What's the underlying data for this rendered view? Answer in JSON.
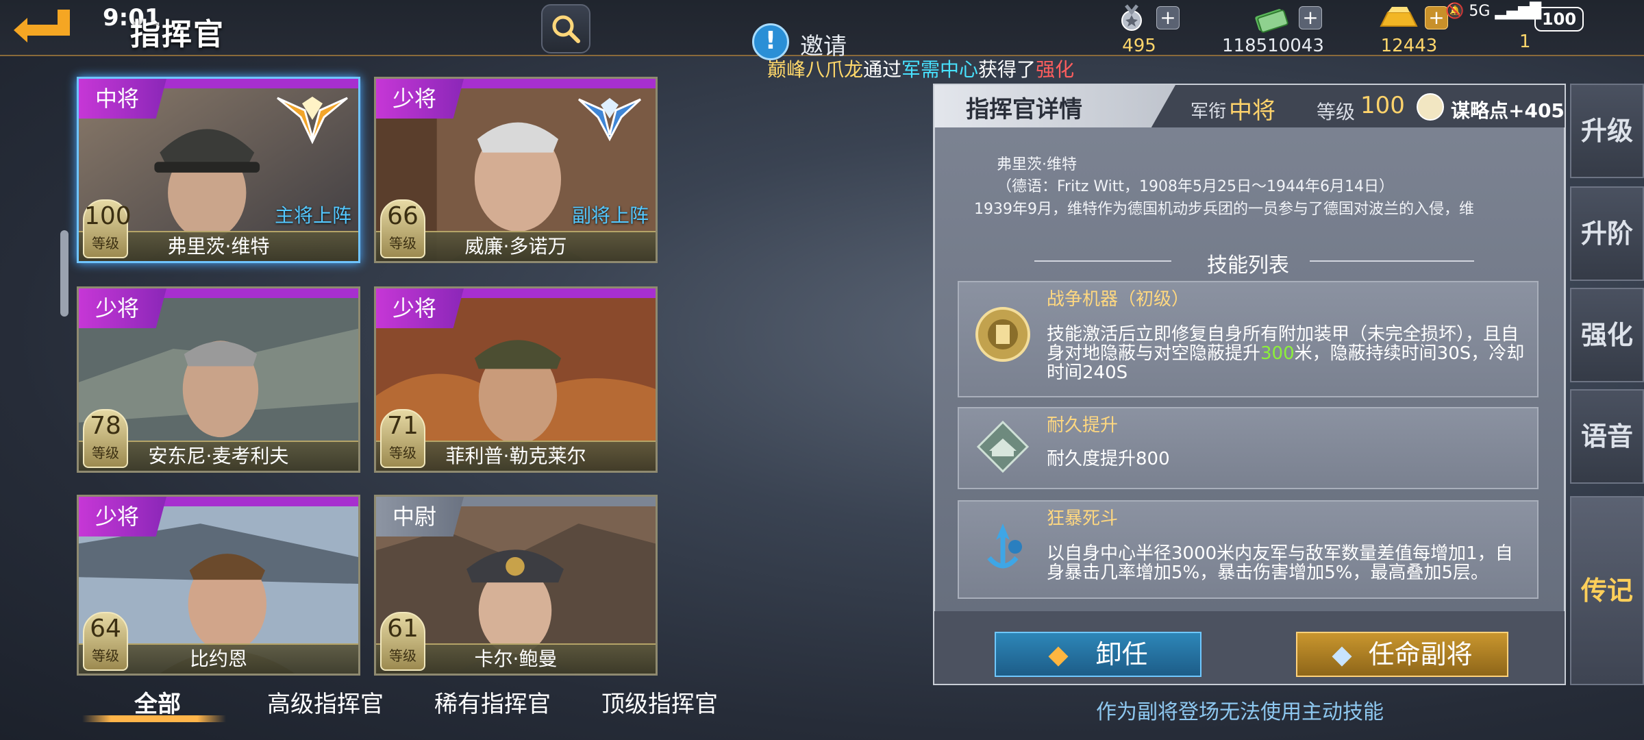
{
  "status_bar": {
    "time": "9:01",
    "signal": "5G",
    "battery": "100"
  },
  "header": {
    "title": "指挥官",
    "invite_label": "邀请",
    "marquee": {
      "player": "巅峰八爪龙",
      "via": "通过",
      "source": "军需中心",
      "got": "获得了",
      "item": "强化"
    }
  },
  "resources": [
    {
      "icon": "medal-icon",
      "value": "495",
      "has_plus": true
    },
    {
      "icon": "cash-icon",
      "value": "118510043",
      "has_plus": true
    },
    {
      "icon": "gold-bar-icon",
      "value": "12443",
      "has_plus": true
    },
    {
      "icon": "ticket-icon",
      "value": "1",
      "has_plus": false
    }
  ],
  "commanders": [
    {
      "rank": "中将",
      "name": "弗里茨·维特",
      "level": "100",
      "level_label": "等级",
      "deploy": "主将上阵",
      "selected": true,
      "rank_color": "purple"
    },
    {
      "rank": "少将",
      "name": "威廉·多诺万",
      "level": "66",
      "level_label": "等级",
      "deploy": "副将上阵",
      "selected": false,
      "rank_color": "purple"
    },
    {
      "rank": "少将",
      "name": "安东尼·麦考利夫",
      "level": "78",
      "level_label": "等级",
      "deploy": "",
      "selected": false,
      "rank_color": "purple"
    },
    {
      "rank": "少将",
      "name": "菲利普·勒克莱尔",
      "level": "71",
      "level_label": "等级",
      "deploy": "",
      "selected": false,
      "rank_color": "purple"
    },
    {
      "rank": "少将",
      "name": "比约恩",
      "level": "64",
      "level_label": "等级",
      "deploy": "",
      "selected": false,
      "rank_color": "purple"
    },
    {
      "rank": "中尉",
      "name": "卡尔·鲍曼",
      "level": "61",
      "level_label": "等级",
      "deploy": "",
      "selected": false,
      "rank_color": "gray"
    }
  ],
  "tabs": [
    {
      "label": "全部",
      "active": true
    },
    {
      "label": "高级指挥官",
      "active": false
    },
    {
      "label": "稀有指挥官",
      "active": false
    },
    {
      "label": "顶级指挥官",
      "active": false
    }
  ],
  "detail": {
    "title": "指挥官详情",
    "rank_label": "军衔",
    "rank_value": "中将",
    "level_label": "等级",
    "level_value": "100",
    "strategy": "谋略点+405",
    "bio_name": "弗里茨·维特",
    "bio_german": "（德语：Fritz Witt，1908年5月25日～1944年6月14日）",
    "bio_text": "1939年9月，维特作为德国机动步兵团的一员参与了德国对波兰的入侵，维",
    "skills_title": "技能列表",
    "skills": [
      {
        "name": "战争机器（初级）",
        "desc_a": "技能激活后立即修复自身所有附加装甲（未完全损坏），且自身对地隐蔽与对空隐蔽提升",
        "highlight": "300",
        "desc_b": "米，隐蔽持续时间30S，冷却时间240S",
        "icon": "war-machine-icon"
      },
      {
        "name": "耐久提升",
        "desc_a": "耐久度提升800",
        "highlight": "",
        "desc_b": "",
        "icon": "durability-icon"
      },
      {
        "name": "狂暴死斗",
        "desc_a": "以自身中心半径3000米内友军与敌军数量差值每增加1，自身暴击几率增加5%，暴击伤害增加5%，最高叠加5层。",
        "highlight": "",
        "desc_b": "",
        "icon": "berserk-icon"
      }
    ],
    "dismiss_label": "卸任",
    "appoint_label": "任命副将",
    "note": "作为副将登场无法使用主动技能"
  },
  "side_nav": [
    {
      "label": "升级",
      "active": false
    },
    {
      "label": "升阶",
      "active": false
    },
    {
      "label": "强化",
      "active": false
    },
    {
      "label": "语音",
      "active": false
    },
    {
      "label": "传记",
      "active": true
    }
  ]
}
